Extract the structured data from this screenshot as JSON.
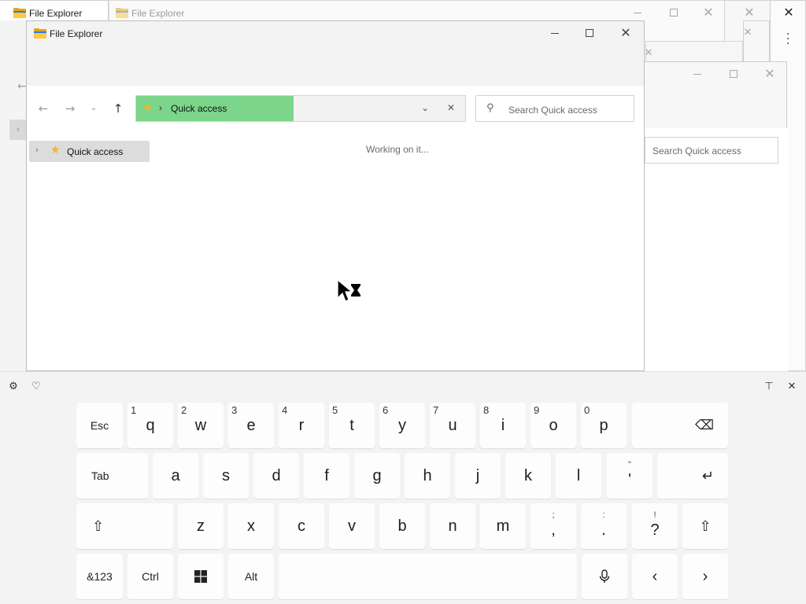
{
  "windows": {
    "back_title_1": "File Explorer",
    "back_title_2": "File Explorer",
    "main_title": "File Explorer",
    "back_search_placeholder": "Search Quick access"
  },
  "explorer": {
    "breadcrumb_location": "Quick access",
    "breadcrumb_separator": "›",
    "search_placeholder": "Search Quick access",
    "tree_item_label": "Quick access",
    "status_text": "Working on it...",
    "nav": {
      "back": "←",
      "forward": "→",
      "recent": "⌄",
      "up": "↑"
    }
  },
  "keyboard": {
    "row1": [
      {
        "label": "Esc"
      },
      {
        "label": "q",
        "hint": "1"
      },
      {
        "label": "w",
        "hint": "2"
      },
      {
        "label": "e",
        "hint": "3"
      },
      {
        "label": "r",
        "hint": "4"
      },
      {
        "label": "t",
        "hint": "5"
      },
      {
        "label": "y",
        "hint": "6"
      },
      {
        "label": "u",
        "hint": "7"
      },
      {
        "label": "i",
        "hint": "8"
      },
      {
        "label": "o",
        "hint": "9"
      },
      {
        "label": "p",
        "hint": "0"
      },
      {
        "label": "⌫"
      }
    ],
    "row2": [
      {
        "label": "Tab"
      },
      {
        "label": "a"
      },
      {
        "label": "s"
      },
      {
        "label": "d"
      },
      {
        "label": "f"
      },
      {
        "label": "g"
      },
      {
        "label": "h"
      },
      {
        "label": "j"
      },
      {
        "label": "k"
      },
      {
        "label": "l"
      },
      {
        "label": "'",
        "top": "\""
      },
      {
        "label": "↵"
      }
    ],
    "row3": [
      {
        "label": "⇧"
      },
      {
        "label": "z"
      },
      {
        "label": "x"
      },
      {
        "label": "c"
      },
      {
        "label": "v"
      },
      {
        "label": "b"
      },
      {
        "label": "n"
      },
      {
        "label": "m"
      },
      {
        "label": ",",
        "top": ";"
      },
      {
        "label": ".",
        "top": ":"
      },
      {
        "label": "?",
        "top": "!"
      },
      {
        "label": "⇧"
      }
    ],
    "row4": [
      {
        "label": "&123"
      },
      {
        "label": "Ctrl"
      },
      {
        "label": "⊞"
      },
      {
        "label": "Alt"
      },
      {
        "label": ""
      },
      {
        "label": "🎙"
      },
      {
        "label": "‹"
      },
      {
        "label": "›"
      }
    ],
    "toolbar": {
      "settings_icon": "⚙",
      "emoji_icon": "♡",
      "dock_icon": "⊤",
      "close_icon": "✕"
    }
  }
}
